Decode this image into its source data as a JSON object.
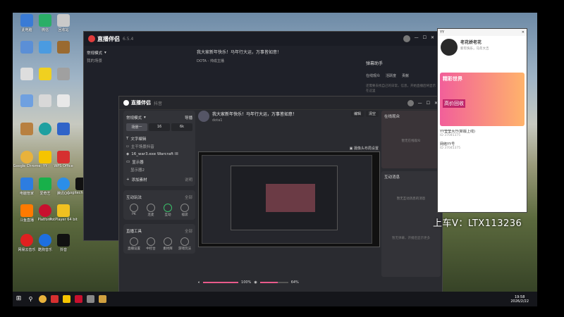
{
  "desktop": {
    "icons": [
      {
        "label": "此电脑",
        "color": "#3a7bd5"
      },
      {
        "label": "微信",
        "color": "#2aae67"
      },
      {
        "label": "回收站",
        "color": "#c9c9c9"
      },
      {
        "label": "Google Chrome",
        "color": "#e8b23c"
      },
      {
        "label": "YY",
        "color": "#f5c400"
      },
      {
        "label": "WPS Office",
        "color": "#d63030"
      },
      {
        "label": "电脑管家",
        "color": "#2d7de0"
      },
      {
        "label": "爱奇艺",
        "color": "#18b04a"
      },
      {
        "label": "腾讯QQ",
        "color": "#2b8ee8"
      },
      {
        "label": "Logitech G HUB",
        "color": "#111111"
      },
      {
        "label": "斗鱼直播",
        "color": "#ff7a00"
      },
      {
        "label": "Platform",
        "color": "#c8102e"
      },
      {
        "label": "PotPlayer 64 bit",
        "color": "#f0c020"
      },
      {
        "label": "网易云音乐",
        "color": "#e02020"
      },
      {
        "label": "酷狗音乐",
        "color": "#1e6fe0"
      },
      {
        "label": "抖音",
        "color": "#111111"
      }
    ]
  },
  "back_window": {
    "app_name": "直播伴侣",
    "version": "6.5.4",
    "mode": "常规模式",
    "scene_title": "我的场景",
    "notice": "我大家新年快乐！马年行大运，万事皆如意！",
    "game_tag": "DOTA - 帅成主播",
    "helper_title": "弹幕助手",
    "helper_tabs": [
      "在线观众",
      "活跃度",
      "贡献"
    ],
    "helper_hint": "还需要去找自己的日常，信息，开始直播后将显示在这里"
  },
  "main_window": {
    "app_name": "直播伴侣",
    "title_sub": "抖音",
    "mode": "常规模式",
    "guide_label": "导播",
    "scene_tabs": [
      "场景一",
      "16",
      "6k"
    ],
    "source_label": "文字编辑",
    "sources": [
      {
        "label": "主干场景抖音"
      },
      {
        "label": "16_war3.exe Warcraft III"
      },
      {
        "label": "显示器"
      },
      {
        "label": "显示器2"
      }
    ],
    "add_source": "添加素材",
    "add_source_hint": "说明",
    "interact_title": "互动玩法",
    "interact_more": "全部",
    "interact_items": [
      "PK",
      "连麦",
      "互动",
      "福袋"
    ],
    "tools_title": "直播工具",
    "tools_more": "全部",
    "tools_items": [
      "直播设置",
      "中控台",
      "素材库",
      "游戏玩法"
    ],
    "notice": "我大家新年快乐！马年行大运，万事皆如意！",
    "stream_id": "dota1",
    "edit_label": "编辑",
    "clear_label": "清空",
    "camera_label": "摄像头布局设置",
    "volume_pct": "100%",
    "mic_pct": "64%",
    "online_title": "在线观众",
    "online_hint": "暂无在线观众",
    "interact_msgs_title": "互动消息",
    "interact_msgs_hint": "暂无互动消息的消息",
    "bottom_hint": "暂无弹幕，开播后显示更多"
  },
  "qq_window": {
    "title": "YY",
    "username": "老花娇老花",
    "status": "新年快乐，马年大吉",
    "tab_label": "精彩世界",
    "promo": "高价回收",
    "list": [
      {
        "name": "YY莹莹大厅(新版上线)",
        "sub": "ID 37045375"
      },
      {
        "name": "网络YY号",
        "sub": "ID 37045375"
      }
    ]
  },
  "watermark": "上车V：LTX113236",
  "taskbar": {
    "time": "19:58",
    "date": "2026/2/22"
  }
}
